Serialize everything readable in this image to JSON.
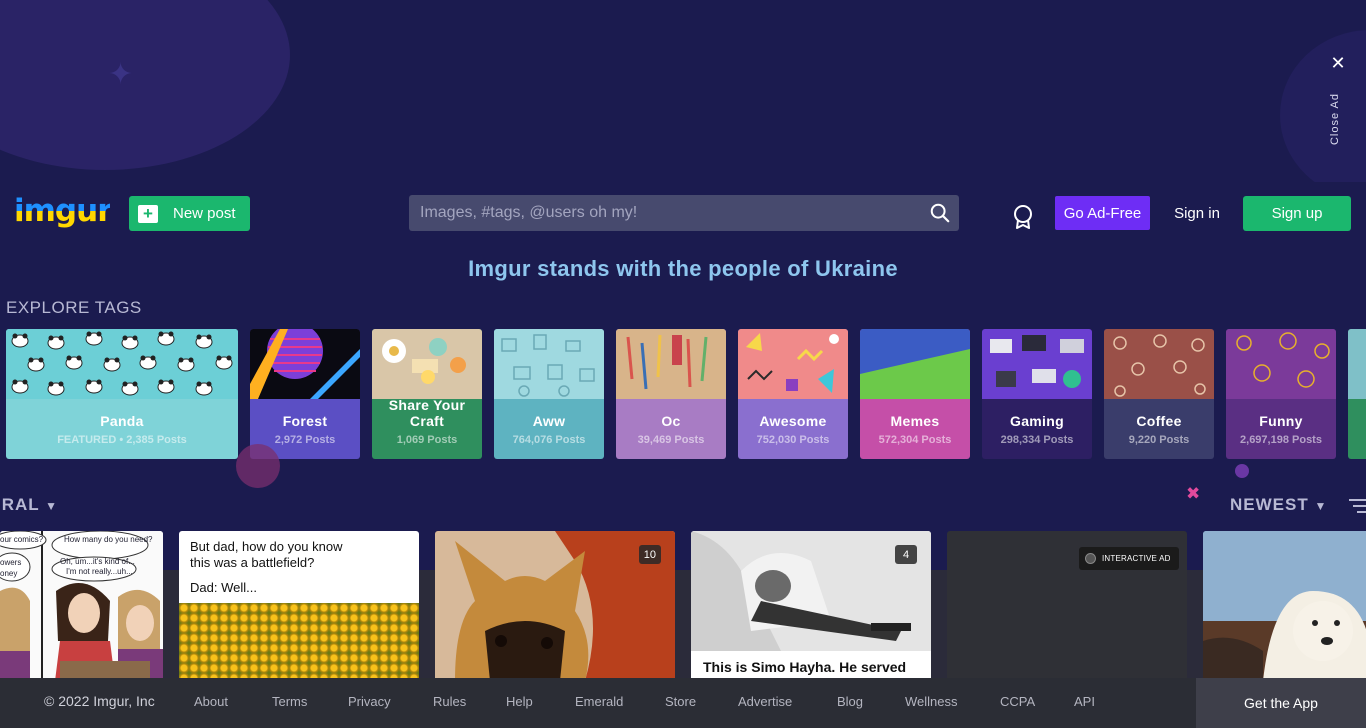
{
  "ad": {
    "close_label": "Close Ad"
  },
  "header": {
    "logo": "imgur",
    "new_post_label": "New post",
    "search_placeholder": "Images, #tags, @users oh my!",
    "ad_free_label": "Go Ad-Free",
    "sign_in_label": "Sign in",
    "sign_up_label": "Sign up"
  },
  "banner": "Imgur stands with the people of Ukraine",
  "explore": {
    "title": "EXPLORE TAGS",
    "tags": [
      {
        "name": "Panda",
        "count": "FEATURED • 2,385 Posts",
        "color": "#7fd3d8"
      },
      {
        "name": "Forest",
        "count": "2,972 Posts",
        "color": "#5b4fc4"
      },
      {
        "name": "Share Your Craft",
        "count": "1,069 Posts",
        "color": "#2f8f5e"
      },
      {
        "name": "Aww",
        "count": "764,076 Posts",
        "color": "#5eb3c1"
      },
      {
        "name": "Oc",
        "count": "39,469 Posts",
        "color": "#a87cc4"
      },
      {
        "name": "Awesome",
        "count": "752,030 Posts",
        "color": "#8a6fcf"
      },
      {
        "name": "Memes",
        "count": "572,304 Posts",
        "color": "#c54fa8"
      },
      {
        "name": "Gaming",
        "count": "298,334 Posts",
        "color": "#2d1f63"
      },
      {
        "name": "Coffee",
        "count": "9,220 Posts",
        "color": "#3a3d6b"
      },
      {
        "name": "Funny",
        "count": "2,697,198 Posts",
        "color": "#5a2f83"
      }
    ]
  },
  "feed": {
    "section_label": "IRAL",
    "sort_label": "NEWEST",
    "posts": [
      {
        "caption": ""
      },
      {
        "caption_line1": "But dad, how do you know",
        "caption_line2": "this was a battlefield?",
        "caption_line3": "Dad: Well..."
      },
      {
        "badge": "10"
      },
      {
        "badge": "4",
        "caption": "This is Simo Hayha. He served"
      },
      {
        "ad_label": "INTERACTIVE AD"
      },
      {
        "caption": ""
      }
    ],
    "comic_texts": [
      "our comics?",
      "How many do you need?",
      "Oh, um...it's kind of...",
      "I'm not really...uh...",
      "owers",
      "oney"
    ]
  },
  "footer": {
    "copyright": "© 2022 Imgur, Inc",
    "links": [
      "About",
      "Terms",
      "Privacy",
      "Rules",
      "Help",
      "Emerald",
      "Store",
      "Advertise",
      "Blog",
      "Wellness",
      "CCPA",
      "API"
    ],
    "get_app": "Get the App"
  },
  "colors": {
    "background": "#1b1b4f",
    "accent_green": "#1bb76e",
    "accent_purple": "#6e2df5",
    "banner_text": "#8ec6ee"
  }
}
